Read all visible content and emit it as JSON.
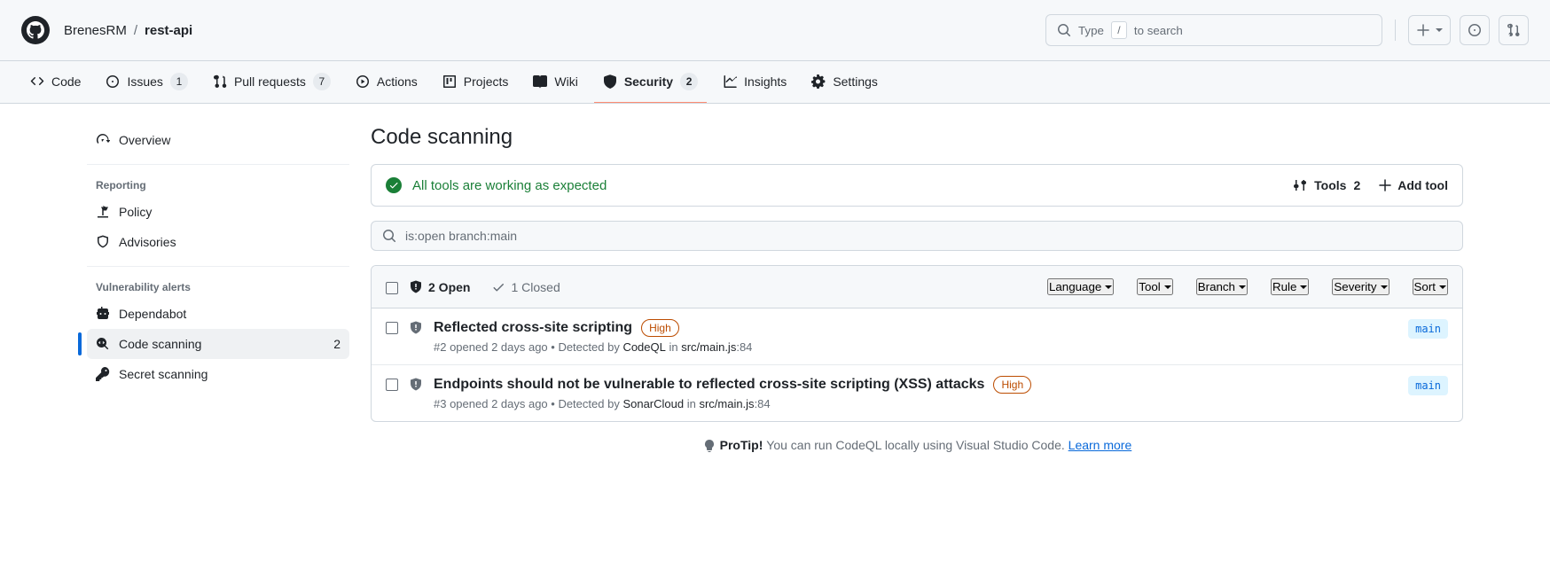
{
  "header": {
    "owner": "BrenesRM",
    "repo": "rest-api",
    "search_text1": "Type ",
    "search_key": "/",
    "search_text2": " to search"
  },
  "nav": {
    "code": "Code",
    "issues": "Issues",
    "issues_n": "1",
    "pr": "Pull requests",
    "pr_n": "7",
    "actions": "Actions",
    "projects": "Projects",
    "wiki": "Wiki",
    "security": "Security",
    "security_n": "2",
    "insights": "Insights",
    "settings": "Settings"
  },
  "sidebar": {
    "overview": "Overview",
    "reporting": "Reporting",
    "policy": "Policy",
    "advisories": "Advisories",
    "vuln": "Vulnerability alerts",
    "dependabot": "Dependabot",
    "code_scanning": "Code scanning",
    "code_scanning_n": "2",
    "secret_scanning": "Secret scanning"
  },
  "main": {
    "title": "Code scanning",
    "status": "All tools are working as expected",
    "tools": "Tools",
    "tools_n": "2",
    "add_tool": "Add tool",
    "filter": "is:open branch:main",
    "open": "2 Open",
    "closed": "1 Closed",
    "f_lang": "Language",
    "f_tool": "Tool",
    "f_branch": "Branch",
    "f_rule": "Rule",
    "f_sev": "Severity",
    "f_sort": "Sort"
  },
  "alerts": [
    {
      "title": "Reflected cross-site scripting",
      "sev": "High",
      "num": "#2",
      "when": "opened 2 days ago",
      "det": "Detected by ",
      "tool": "CodeQL",
      "in": " in ",
      "file": "src/main.js",
      "line": ":84",
      "branch": "main"
    },
    {
      "title": "Endpoints should not be vulnerable to reflected cross-site scripting (XSS) attacks",
      "sev": "High",
      "num": "#3",
      "when": "opened 2 days ago",
      "det": "Detected by ",
      "tool": "SonarCloud",
      "in": " in ",
      "file": "src/main.js",
      "line": ":84",
      "branch": "main"
    }
  ],
  "protip": {
    "label": "ProTip! ",
    "text": "You can run CodeQL locally using Visual Studio Code. ",
    "link": "Learn more"
  }
}
